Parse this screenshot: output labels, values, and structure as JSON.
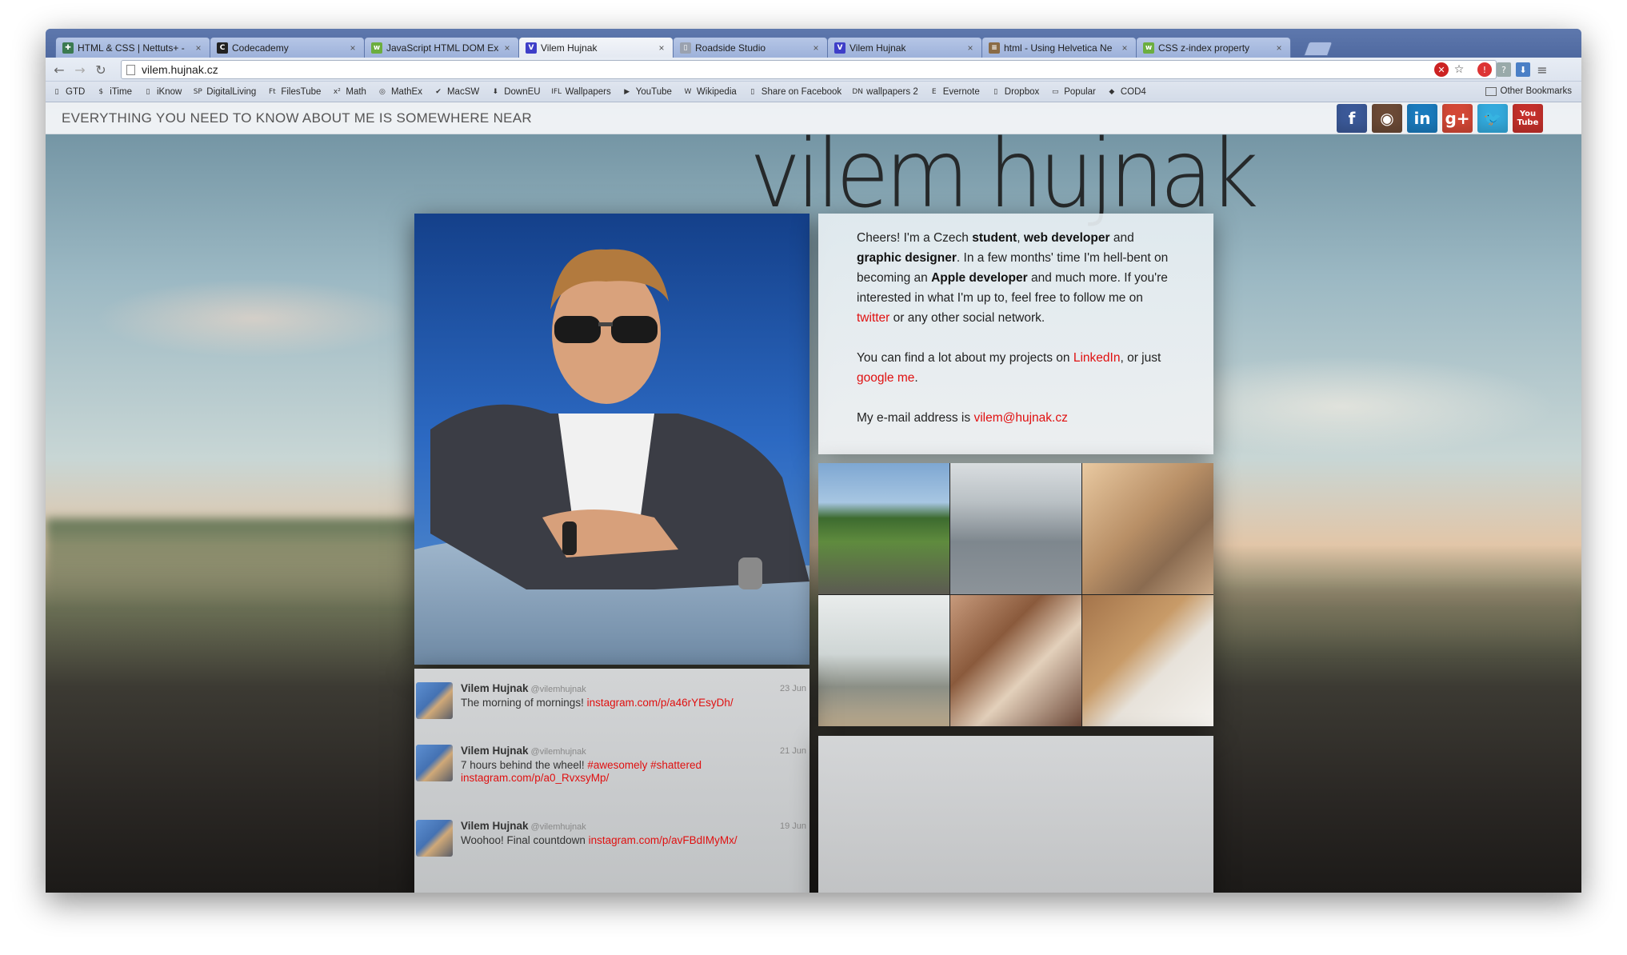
{
  "browser": {
    "tabs": [
      {
        "title": "HTML & CSS | Nettuts+ - ",
        "fav": "✚",
        "fav_color": "#3b7a50"
      },
      {
        "title": "Codecademy",
        "fav": "C",
        "fav_color": "#222222"
      },
      {
        "title": "JavaScript HTML DOM Exa",
        "fav": "w",
        "fav_color": "#6cae3f"
      },
      {
        "title": "Vilem Hujnak",
        "fav": "V",
        "fav_color": "#3e3ec8"
      },
      {
        "title": "Roadside Studio",
        "fav": "▯",
        "fav_color": "#9aa2b0"
      },
      {
        "title": "Vilem Hujnak",
        "fav": "V",
        "fav_color": "#3e3ec8"
      },
      {
        "title": "html - Using Helvetica Ne",
        "fav": "≡",
        "fav_color": "#8a6b45"
      },
      {
        "title": "CSS z-index property",
        "fav": "w",
        "fav_color": "#6cae3f"
      }
    ],
    "active_tab": 3,
    "url": "vilem.hujnak.cz",
    "bookmarks": [
      {
        "label": "GTD",
        "icon": "▯"
      },
      {
        "label": "iTime",
        "icon": "$"
      },
      {
        "label": "iKnow",
        "icon": "▯"
      },
      {
        "label": "DigitalLiving",
        "icon": "SP"
      },
      {
        "label": "FilesTube",
        "icon": "Ft"
      },
      {
        "label": "Math",
        "icon": "x²"
      },
      {
        "label": "MathEx",
        "icon": "◎"
      },
      {
        "label": "MacSW",
        "icon": "✔"
      },
      {
        "label": "DownEU",
        "icon": "⬇"
      },
      {
        "label": "Wallpapers",
        "icon": "IFL"
      },
      {
        "label": "YouTube",
        "icon": "▶"
      },
      {
        "label": "Wikipedia",
        "icon": "W"
      },
      {
        "label": "Share on Facebook",
        "icon": "▯"
      },
      {
        "label": "wallpapers 2",
        "icon": "DN"
      },
      {
        "label": "Evernote",
        "icon": "E"
      },
      {
        "label": "Dropbox",
        "icon": "▯"
      },
      {
        "label": "Popular",
        "icon": "▭"
      },
      {
        "label": "COD4",
        "icon": "◆"
      }
    ],
    "other_bookmarks": "Other Bookmarks"
  },
  "site": {
    "tagline": "EVERYTHING YOU NEED TO KNOW ABOUT ME IS SOMEWHERE NEAR",
    "name": "vilem hujnak",
    "social": [
      {
        "name": "facebook",
        "glyph": "f",
        "color": "#3b5998"
      },
      {
        "name": "instagram",
        "glyph": "◉",
        "color": "#6b4a36"
      },
      {
        "name": "linkedin",
        "glyph": "in",
        "color": "#1a7bbd"
      },
      {
        "name": "googleplus",
        "glyph": "g+",
        "color": "#d34836"
      },
      {
        "name": "twitter",
        "glyph": "🐦",
        "color": "#33aadd"
      },
      {
        "name": "youtube",
        "glyph": "You Tube",
        "color": "#c4302b"
      }
    ],
    "bio": {
      "p1": [
        {
          "t": "Cheers! I'm a Czech "
        },
        {
          "t": "student",
          "b": true
        },
        {
          "t": ", "
        },
        {
          "t": "web developer",
          "b": true
        },
        {
          "t": " and "
        },
        {
          "t": "graphic designer",
          "b": true
        },
        {
          "t": ". In a few months' time I'm hell-bent on becoming an "
        },
        {
          "t": "Apple developer",
          "b": true
        },
        {
          "t": " and much more. If you're interested in what I'm up to, feel free to follow me on "
        },
        {
          "t": "twitter",
          "link": true
        },
        {
          "t": " or any other social network."
        }
      ],
      "p2": [
        {
          "t": "You can find a lot about my projects on "
        },
        {
          "t": "LinkedIn",
          "link": true
        },
        {
          "t": ", or just "
        },
        {
          "t": "google me",
          "link": true
        },
        {
          "t": "."
        }
      ],
      "p3": [
        {
          "t": "My e-mail address is "
        },
        {
          "t": "vilem@hujnak.cz",
          "link": true
        }
      ]
    },
    "tweets": [
      {
        "name": "Vilem Hujnak",
        "handle": "@vilemhujnak",
        "date": "23 Jun",
        "text": "The morning of mornings! ",
        "link": "instagram.com/p/a46rYEsyDh/"
      },
      {
        "name": "Vilem Hujnak",
        "handle": "@vilemhujnak",
        "date": "21 Jun",
        "text": "7 hours behind the wheel! ",
        "hashtags": "#awesomely #shattered",
        "link": "instagram.com/p/a0_RvxsyMp/"
      },
      {
        "name": "Vilem Hujnak",
        "handle": "@vilemhujnak",
        "date": "19 Jun",
        "text": "Woohoo! Final countdown ",
        "link": "instagram.com/p/avFBdIMyMx/"
      }
    ]
  }
}
